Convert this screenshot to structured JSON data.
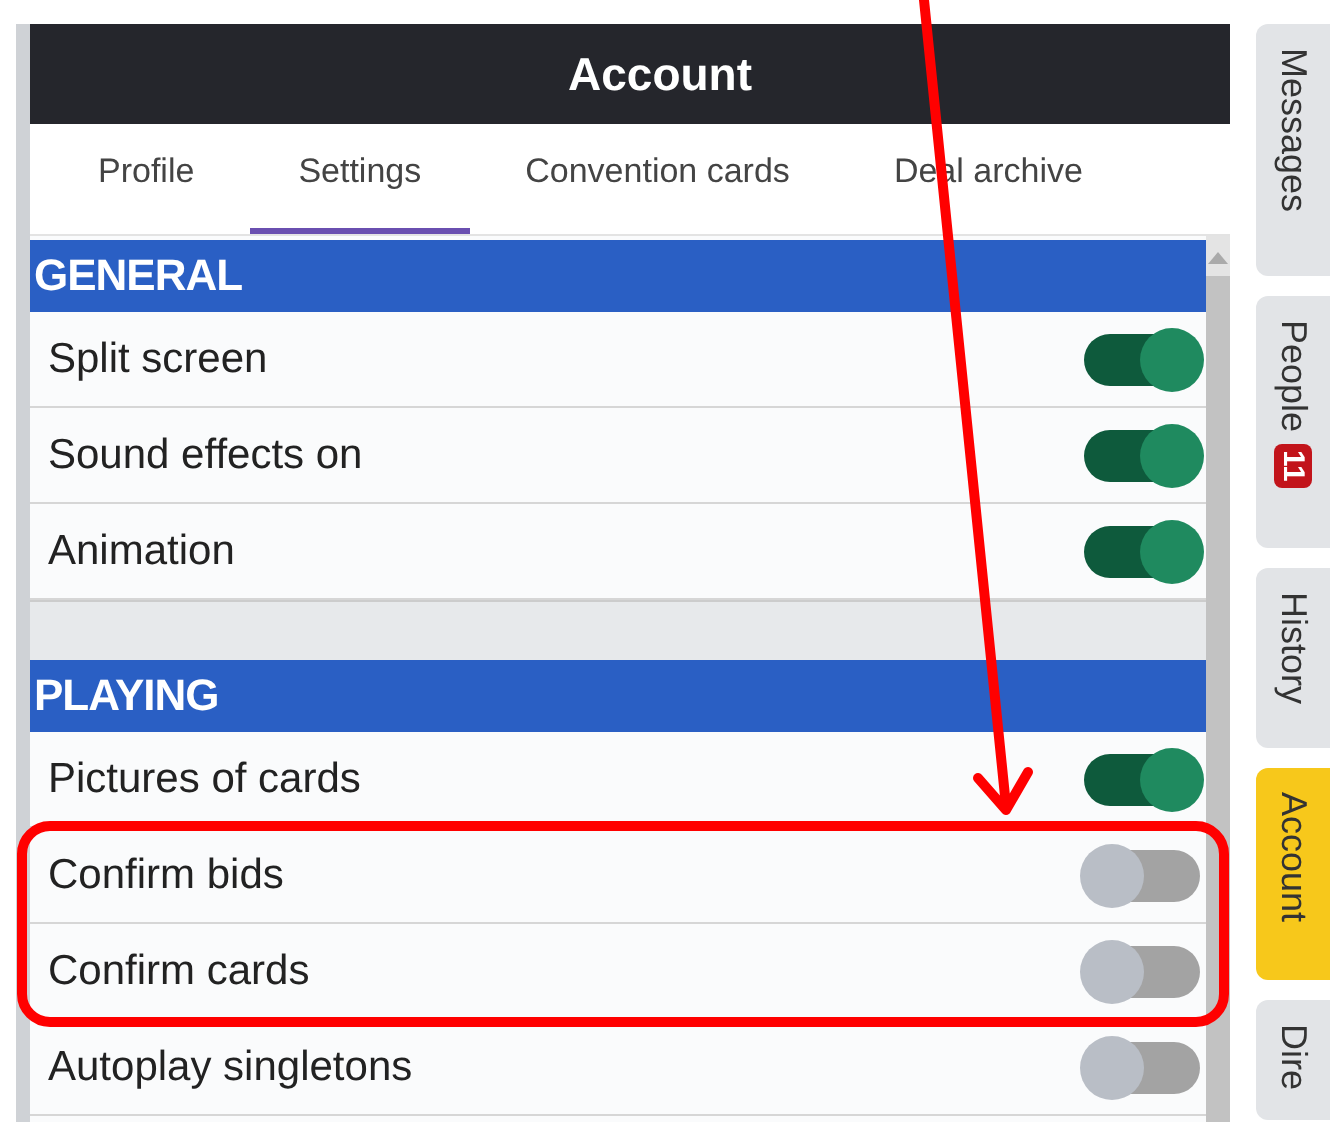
{
  "window": {
    "title": "Account"
  },
  "tabs": [
    {
      "label": "Profile",
      "selected": false
    },
    {
      "label": "Settings",
      "selected": true
    },
    {
      "label": "Convention cards",
      "selected": false
    },
    {
      "label": "Deal archive",
      "selected": false
    }
  ],
  "sections": [
    {
      "title": "GENERAL",
      "items": [
        {
          "label": "Split screen",
          "on": true,
          "highlighted": false
        },
        {
          "label": "Sound effects on",
          "on": true,
          "highlighted": false
        },
        {
          "label": "Animation",
          "on": true,
          "highlighted": false
        }
      ]
    },
    {
      "title": "PLAYING",
      "items": [
        {
          "label": "Pictures of cards",
          "on": true,
          "highlighted": false
        },
        {
          "label": "Confirm bids",
          "on": false,
          "highlighted": true
        },
        {
          "label": "Confirm cards",
          "on": false,
          "highlighted": true
        },
        {
          "label": "Autoplay singletons",
          "on": false,
          "highlighted": false
        }
      ]
    }
  ],
  "side_tabs": [
    {
      "label": "Messages",
      "selected": false
    },
    {
      "label": "People",
      "badge": "11",
      "selected": false
    },
    {
      "label": "History",
      "selected": false
    },
    {
      "label": "Account",
      "selected": true
    },
    {
      "label": "Dire",
      "selected": false
    }
  ]
}
